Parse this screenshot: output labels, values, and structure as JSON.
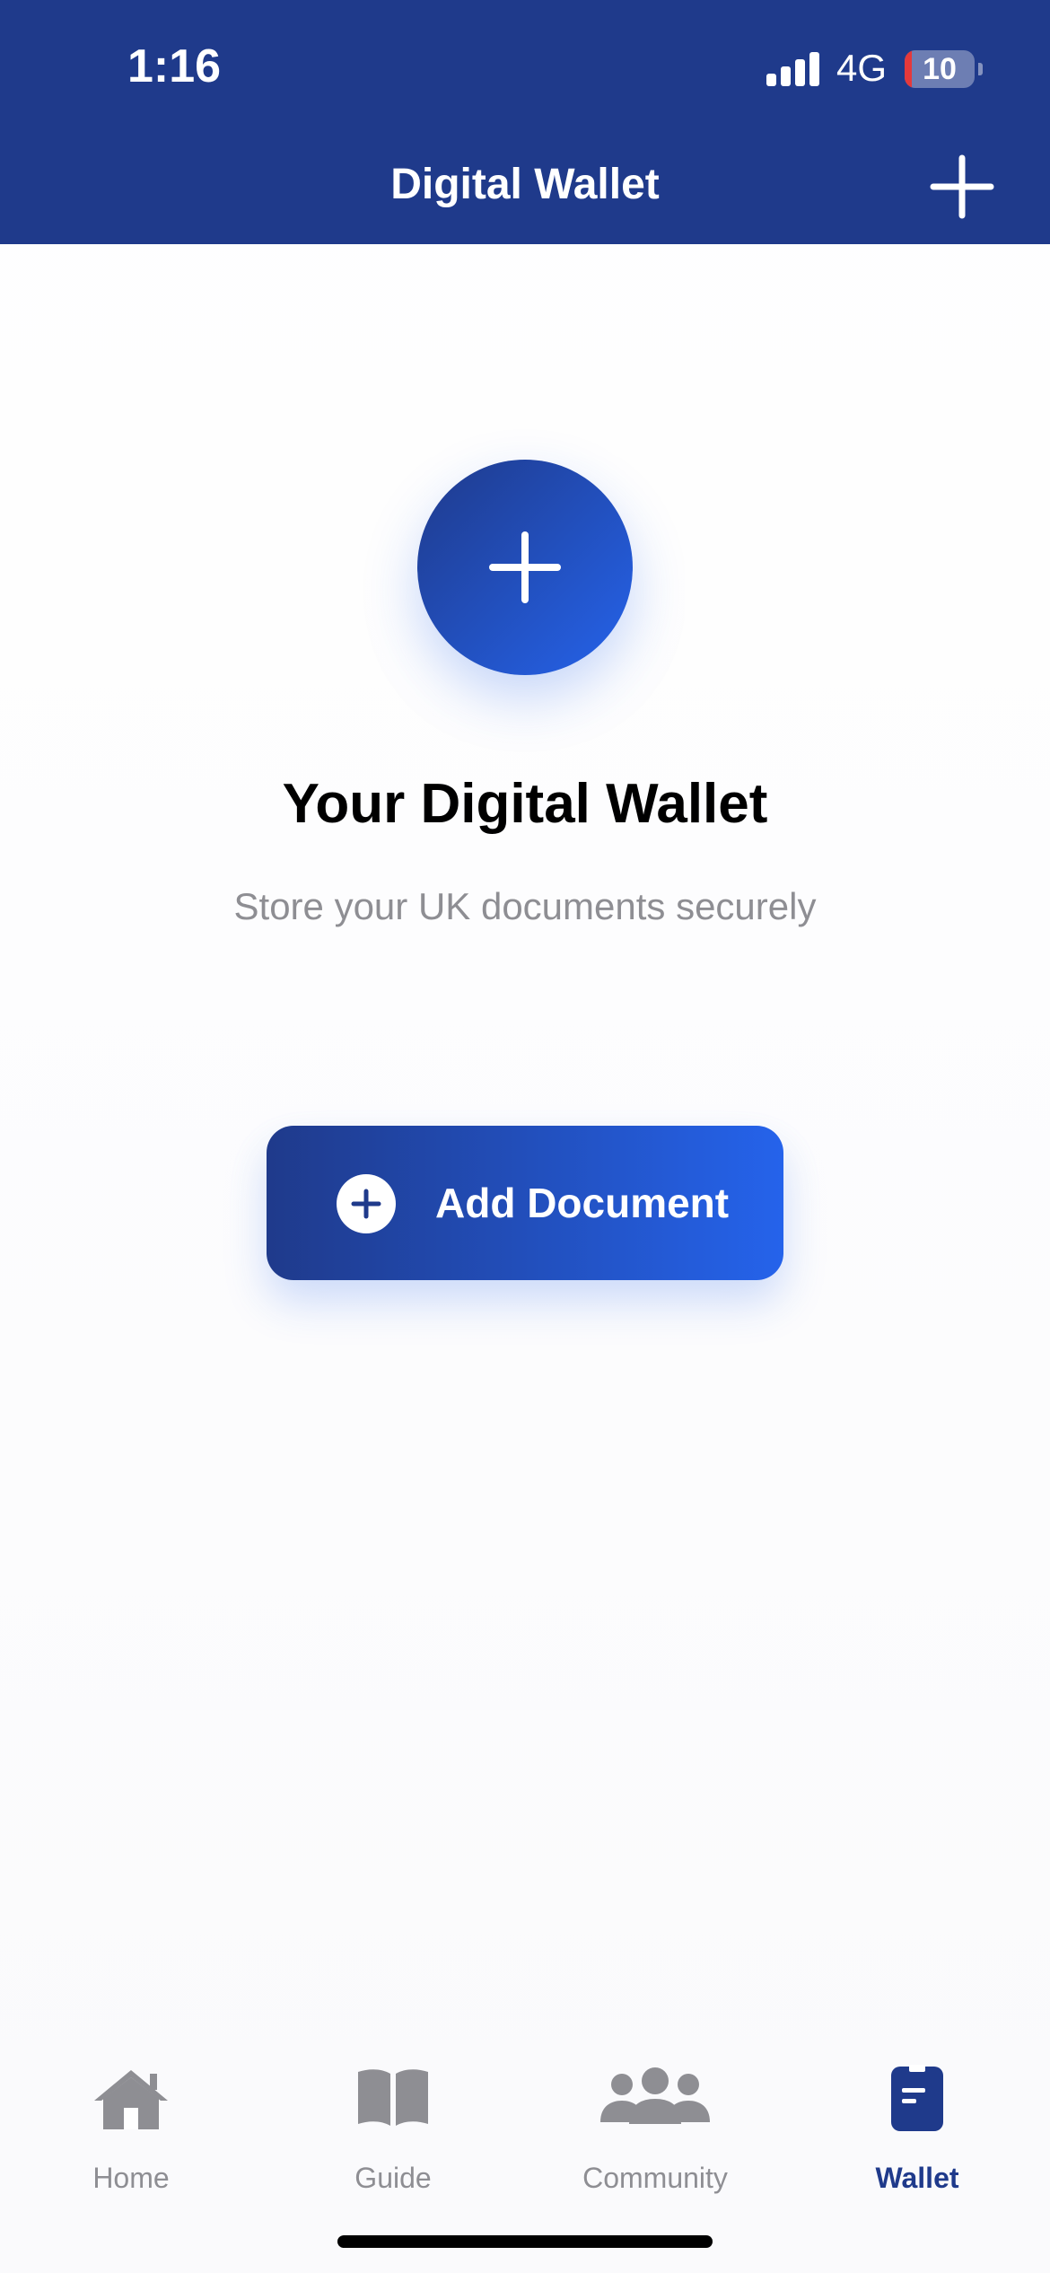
{
  "status_bar": {
    "time": "1:16",
    "network": "4G",
    "battery_level": "10",
    "battery_fraction": 0.1
  },
  "header": {
    "title": "Digital Wallet",
    "add_icon": "plus-icon"
  },
  "empty_state": {
    "icon": "plus-icon",
    "title": "Your Digital Wallet",
    "subtitle": "Store your UK documents securely",
    "button_label": "Add Document"
  },
  "tabs": [
    {
      "label": "Home",
      "icon": "home-icon",
      "active": false
    },
    {
      "label": "Guide",
      "icon": "book-icon",
      "active": false
    },
    {
      "label": "Community",
      "icon": "people-icon",
      "active": false
    },
    {
      "label": "Wallet",
      "icon": "wallet-icon",
      "active": true
    }
  ],
  "colors": {
    "brand_primary": "#1f3a8b",
    "brand_gradient_end": "#2563eb",
    "tab_inactive": "#8e8e93",
    "battery_low": "#e5393b"
  }
}
